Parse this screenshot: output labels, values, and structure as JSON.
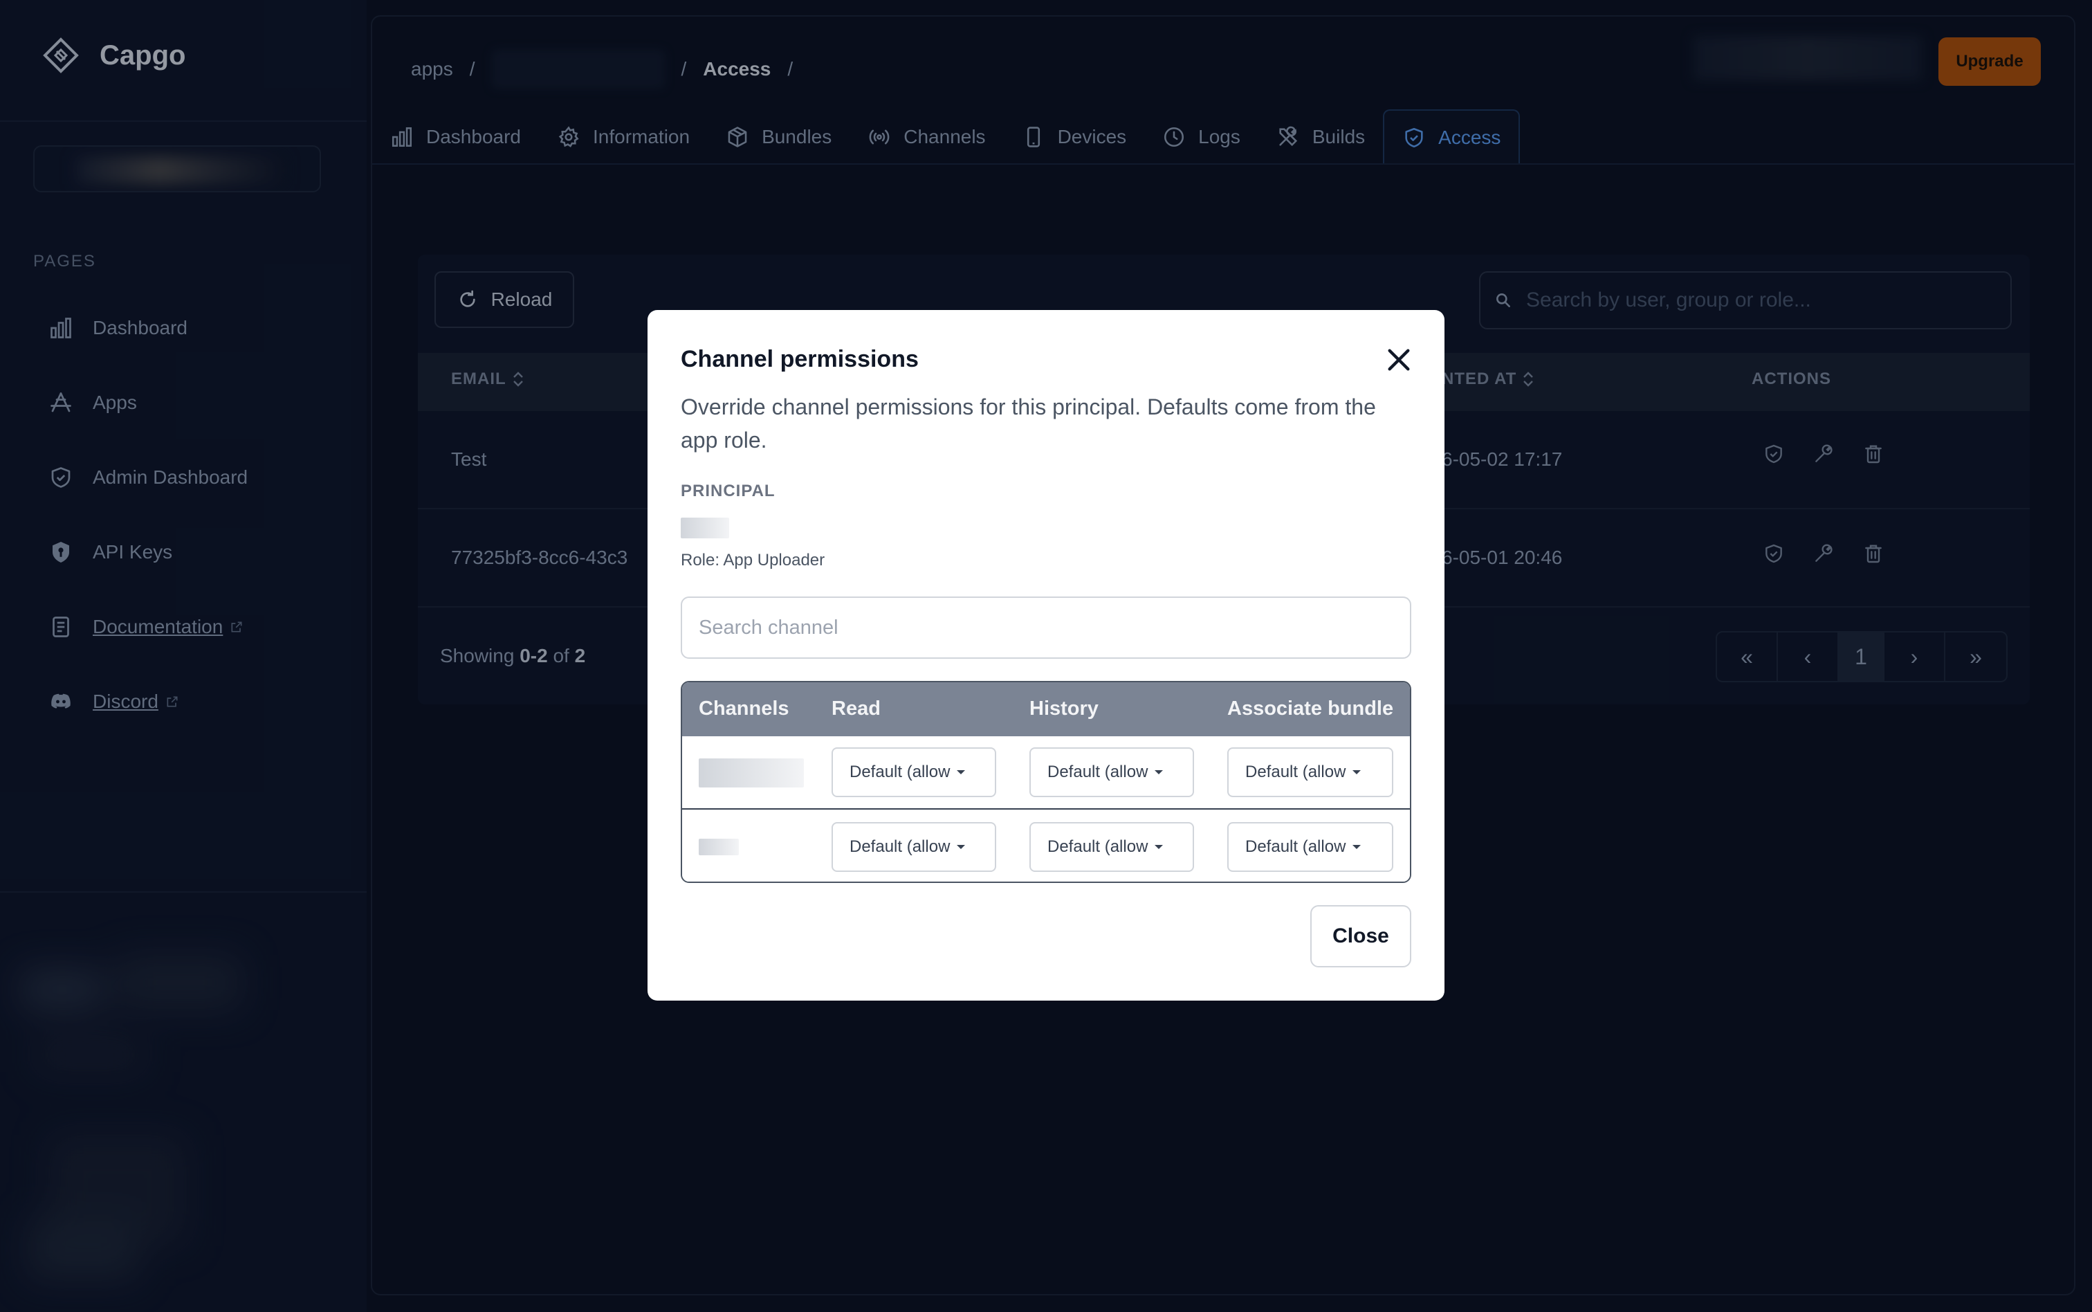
{
  "app": {
    "name": "Capgo"
  },
  "sidebar": {
    "section_label": "PAGES",
    "items": [
      {
        "label": "Dashboard",
        "icon": "bar-chart-icon"
      },
      {
        "label": "Apps",
        "icon": "app-store-icon"
      },
      {
        "label": "Admin Dashboard",
        "icon": "shield-check-icon"
      },
      {
        "label": "API Keys",
        "icon": "key-shield-icon"
      },
      {
        "label": "Documentation",
        "icon": "document-icon",
        "external": true
      },
      {
        "label": "Discord",
        "icon": "discord-icon",
        "external": true
      }
    ]
  },
  "breadcrumb": {
    "root": "apps",
    "separator": "/",
    "current": "Access"
  },
  "header": {
    "upgrade_label": "Upgrade"
  },
  "tabs": [
    {
      "label": "Dashboard",
      "icon": "bar-chart-icon"
    },
    {
      "label": "Information",
      "icon": "gear-icon"
    },
    {
      "label": "Bundles",
      "icon": "package-icon"
    },
    {
      "label": "Channels",
      "icon": "broadcast-icon"
    },
    {
      "label": "Devices",
      "icon": "phone-icon"
    },
    {
      "label": "Logs",
      "icon": "clock-icon"
    },
    {
      "label": "Builds",
      "icon": "tools-icon"
    },
    {
      "label": "Access",
      "icon": "shield-check-icon",
      "active": true
    }
  ],
  "access_table": {
    "reload_label": "Reload",
    "search_placeholder": "Search by user, group or role...",
    "columns": {
      "email": "EMAIL",
      "granted_at": "NTED AT",
      "actions": "ACTIONS"
    },
    "rows": [
      {
        "email": "Test",
        "granted_at": "6-05-02 17:17"
      },
      {
        "email": "77325bf3-8cc6-43c3",
        "granted_at": "6-05-01 20:46"
      }
    ],
    "showing_prefix": "Showing",
    "showing_range": "0-2",
    "showing_of": "of",
    "showing_total": "2",
    "pager": {
      "first": "«",
      "prev": "‹",
      "page": "1",
      "next": "›",
      "last": "»"
    }
  },
  "modal": {
    "title": "Channel permissions",
    "description": "Override channel permissions for this principal. Defaults come from the app role.",
    "principal_label": "PRINCIPAL",
    "role_text": "Role: App Uploader",
    "search_placeholder": "Search channel",
    "columns": [
      "Channels",
      "Read",
      "History",
      "Associate bundle"
    ],
    "rows": [
      {
        "read": "Default (allow",
        "history": "Default (allow",
        "associate": "Default (allow"
      },
      {
        "read": "Default (allow",
        "history": "Default (allow",
        "associate": "Default (allow"
      }
    ],
    "close_label": "Close"
  },
  "colors": {
    "accent": "#60a5fa",
    "upgrade": "#b45309",
    "background": "#0b1221",
    "modal_header": "#7b8494"
  }
}
